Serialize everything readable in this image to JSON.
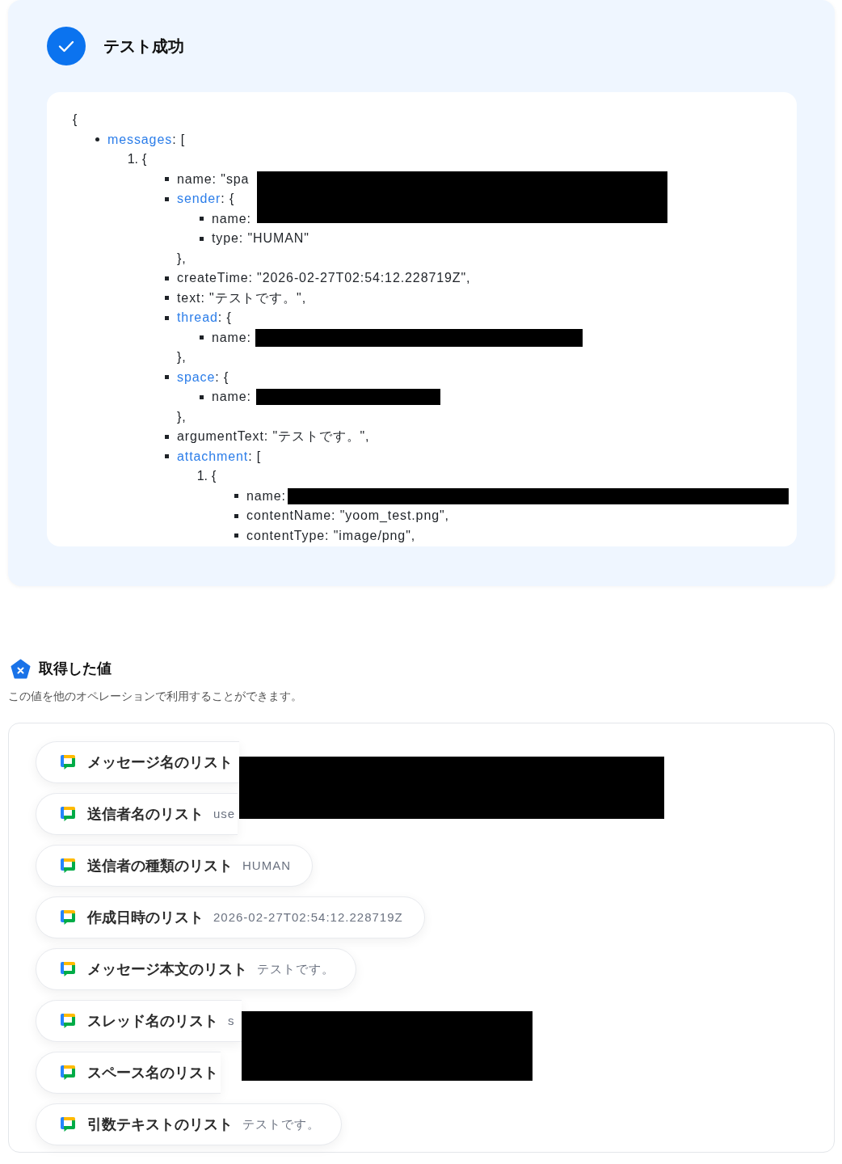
{
  "test_result": {
    "title": "テスト成功",
    "tree": {
      "open": "{",
      "entries": [
        {
          "kind": "branch",
          "key": "messages",
          "after_key": ": [",
          "children": [
            {
              "kind": "numbered",
              "number": "1.",
              "text": "{",
              "children": [
                {
                  "kind": "leaf",
                  "text": "name: \"spa",
                  "redacted": true
                },
                {
                  "kind": "branch",
                  "key": "sender",
                  "after_key": ": {",
                  "children": [
                    {
                      "kind": "leaf",
                      "text": "name:"
                    },
                    {
                      "kind": "leaf",
                      "text": "type: \"HUMAN\""
                    }
                  ],
                  "close": "},"
                },
                {
                  "kind": "leaf",
                  "text": "createTime: \"2026-02-27T02:54:12.228719Z\","
                },
                {
                  "kind": "leaf",
                  "text": "text: \"テストです。\","
                },
                {
                  "kind": "branch",
                  "key": "thread",
                  "after_key": ": {",
                  "children": [
                    {
                      "kind": "leaf",
                      "text": "name:",
                      "redacted": true
                    }
                  ],
                  "close": "},"
                },
                {
                  "kind": "branch",
                  "key": "space",
                  "after_key": ": {",
                  "children": [
                    {
                      "kind": "leaf",
                      "text": "name:",
                      "redacted": true
                    }
                  ],
                  "close": "},"
                },
                {
                  "kind": "leaf",
                  "text": "argumentText: \"テストです。\","
                },
                {
                  "kind": "branch",
                  "key": "attachment",
                  "after_key": ": [",
                  "children": [
                    {
                      "kind": "numbered",
                      "number": "1.",
                      "text": "{",
                      "children": [
                        {
                          "kind": "leaf",
                          "text": "name:",
                          "redacted": true
                        },
                        {
                          "kind": "leaf",
                          "text": "contentName: \"yoom_test.png\","
                        },
                        {
                          "kind": "leaf",
                          "text": "contentType: \"image/png\","
                        }
                      ]
                    }
                  ]
                }
              ]
            }
          ]
        }
      ]
    }
  },
  "fetched_values": {
    "title": "取得した値",
    "description": "この値を他のオペレーションで利用することができます。",
    "items": [
      {
        "label": "メッセージ名のリスト",
        "redacted": true
      },
      {
        "label": "送信者名のリスト",
        "value": "use",
        "covered": true
      },
      {
        "label": "送信者の種類のリスト",
        "value": "HUMAN"
      },
      {
        "label": "作成日時のリスト",
        "value": "2026-02-27T02:54:12.228719Z"
      },
      {
        "label": "メッセージ本文のリスト",
        "value": "テストです。"
      },
      {
        "label": "スレッド名のリスト",
        "value": "s",
        "redacted": true
      },
      {
        "label": "スペース名のリスト",
        "covered": true
      },
      {
        "label": "引数テキストのリスト",
        "value": "テストです。"
      }
    ]
  }
}
